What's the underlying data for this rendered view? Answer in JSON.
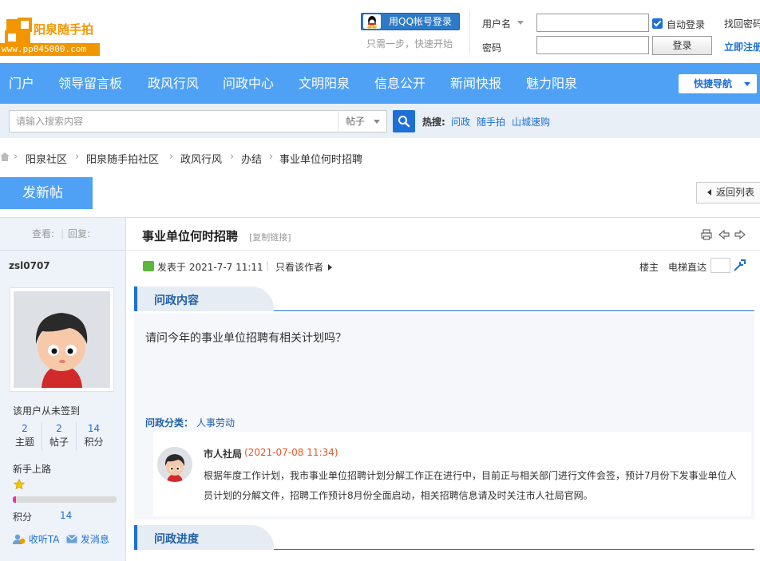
{
  "brand": {
    "logo_text": "阳泉随手拍",
    "logo_url": "www.pp045000.com",
    "accent": "#4ea1f5",
    "link": "#1d6fd6",
    "logo_orange": "#f29600"
  },
  "login": {
    "qq_label": "用QQ帐号登录",
    "qq_hint": "只需一步，快速开始",
    "username_label": "用户名",
    "password_label": "密码",
    "auto_login": "自动登录",
    "auto_login_checked": true,
    "login_button": "登录",
    "find_password": "找回密码",
    "register": "立即注册"
  },
  "nav": {
    "items": [
      "门户",
      "领导留言板",
      "政风行风",
      "问政中心",
      "文明阳泉",
      "信息公开",
      "新闻快报",
      "魅力阳泉"
    ],
    "quick_nav": "快捷导航"
  },
  "search": {
    "placeholder": "请输入搜索内容",
    "type": "帖子",
    "hot_label": "热搜:",
    "hot": [
      "问政",
      "随手拍",
      "山城速购"
    ]
  },
  "breadcrumb": [
    "阳泉社区",
    "阳泉随手拍社区",
    "政风行风",
    "办结",
    "事业单位何时招聘"
  ],
  "actions": {
    "new_post": "发新帖",
    "back_list": "返回列表"
  },
  "sidebar": {
    "view_label": "查看:",
    "reply_label": "回复:",
    "username": "zsl0707",
    "sign_status": "该用户从未签到",
    "stats": [
      {
        "num": "2",
        "label": "主题"
      },
      {
        "num": "2",
        "label": "帖子"
      },
      {
        "num": "14",
        "label": "积分"
      }
    ],
    "level": "新手上路",
    "level_progress": 0.03,
    "score_label": "积分",
    "score_value": "14",
    "follow": "收听TA",
    "message": "发消息"
  },
  "post": {
    "title": "事业单位何时招聘",
    "copy_link": "[复制链接]",
    "posted_at": "发表于 2021-7-7 11:11",
    "only_author": "只看该作者",
    "floor": "楼主",
    "elevator": "电梯直达",
    "section_content": "问政内容",
    "question": "请问今年的事业单位招聘有相关计划吗？",
    "category_label": "问政分类：",
    "category_value": "人事劳动",
    "reply": {
      "name": "市人社局",
      "date": "(2021-07-08 11:34)",
      "text": "根据年度工作计划，我市事业单位招聘计划分解工作正在进行中，目前正与相关部门进行文件会签，预计7月份下发事业单位人员计划的分解文件，招聘工作预计8月份全面启动，相关招聘信息请及时关注市人社局官网。"
    },
    "section_progress": "问政进度"
  }
}
